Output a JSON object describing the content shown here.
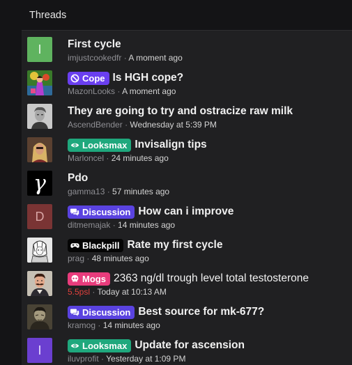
{
  "panel": {
    "title": "Threads"
  },
  "threads": [
    {
      "title": "First cycle",
      "prefix": null,
      "user": "imjustcookedfr",
      "time": "A moment ago",
      "avatar": {
        "type": "letter",
        "letter": "I",
        "bg": "#5fb35f",
        "fg": "#e8f5e8"
      }
    },
    {
      "title": "Is HGH cope?",
      "prefix": {
        "label": "Cope",
        "icon": "ban-icon",
        "color": "#6a3ff0"
      },
      "user": "MazonLooks",
      "time": "A moment ago",
      "avatar": {
        "type": "image",
        "icon": "colorful-figure-avatar"
      }
    },
    {
      "title": "They are going to try and ostracize raw milk",
      "prefix": null,
      "user": "AscendBender",
      "time": "Wednesday at 5:39 PM",
      "avatar": {
        "type": "image",
        "icon": "grayscale-portrait-avatar"
      }
    },
    {
      "title": "Invisalign tips",
      "prefix": {
        "label": "Looksmax",
        "icon": "eye-icon",
        "color": "#1fa87d"
      },
      "user": "Marloncel",
      "time": "24 minutes ago",
      "avatar": {
        "type": "image",
        "icon": "blonde-portrait-avatar"
      }
    },
    {
      "title": "Pdo",
      "prefix": null,
      "user": "gamma13",
      "time": "57 minutes ago",
      "avatar": {
        "type": "glyph",
        "glyph": "γ",
        "bg": "#000000",
        "fg": "#ffffff"
      }
    },
    {
      "title": "How can i improve",
      "prefix": {
        "label": "Discussion",
        "icon": "chat-bubbles-icon",
        "color": "#5a43e0"
      },
      "user": "ditmemajak",
      "time": "14 minutes ago",
      "avatar": {
        "type": "letter",
        "letter": "D",
        "bg": "#7a3434",
        "fg": "#d9a5a5"
      }
    },
    {
      "title": "Rate my first cycle",
      "prefix": {
        "label": "Blackpill",
        "icon": "gamepad-icon",
        "color": "#050505"
      },
      "user": "prag",
      "time": "48 minutes ago",
      "avatar": {
        "type": "image",
        "icon": "manga-portrait-avatar"
      }
    },
    {
      "title": "2363 ng/dl trough level total testosterone",
      "prefix": {
        "label": "Mogs",
        "icon": "skull-icon",
        "color": "#e83c7c"
      },
      "user": "5.5psl",
      "user_color": "red",
      "time": "Today at 10:13 AM",
      "light": true,
      "avatar": {
        "type": "image",
        "icon": "mustache-portrait-avatar"
      }
    },
    {
      "title": "Best source for mk-677?",
      "prefix": {
        "label": "Discussion",
        "icon": "chat-bubbles-icon",
        "color": "#5a43e0"
      },
      "user": "kramog",
      "time": "14 minutes ago",
      "avatar": {
        "type": "image",
        "icon": "dark-sketch-avatar"
      }
    },
    {
      "title": "Update for ascension",
      "prefix": {
        "label": "Looksmax",
        "icon": "eye-icon",
        "color": "#1fa87d"
      },
      "user": "iluvprofit",
      "time": "Yesterday at 1:09 PM",
      "avatar": {
        "type": "letter",
        "letter": "I",
        "bg": "#6b3fd0",
        "fg": "#e6dcff"
      }
    }
  ],
  "colors": {
    "background": "#202022",
    "header": "#141416",
    "title_text": "#f1f1f1",
    "meta_text": "#8e8e93",
    "time_text": "#d4d4d4"
  }
}
